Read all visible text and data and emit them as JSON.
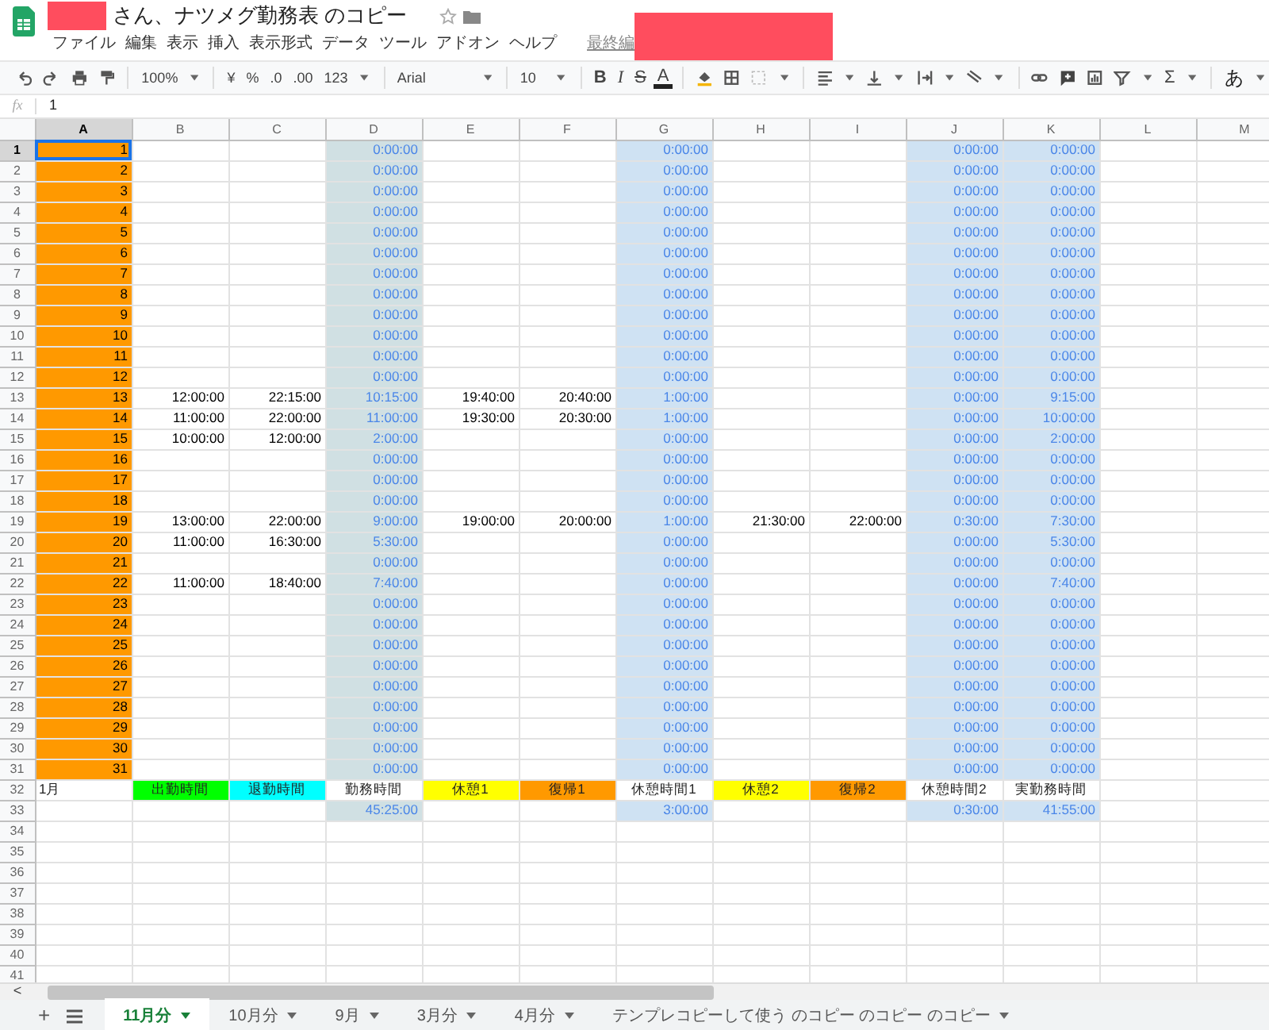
{
  "document": {
    "title": "さん、ナツメグ勤務表 のコピー",
    "last_edit": "最終編"
  },
  "menu": [
    "ファイル",
    "編集",
    "表示",
    "挿入",
    "表示形式",
    "データ",
    "ツール",
    "アドオン",
    "ヘルプ"
  ],
  "toolbar": {
    "zoom": "100%",
    "currency": "¥",
    "percent": "%",
    "decimal_decrease": ".0",
    "decimal_increase": ".00",
    "number_format": "123",
    "font": "Arial",
    "font_size": "10",
    "bold": "B",
    "italic": "I",
    "strikethrough": "S",
    "text_color": "A",
    "functions": "Σ",
    "input_tools": "あ"
  },
  "formula_bar": {
    "label": "fx",
    "value": "1"
  },
  "sheet": {
    "columns": [
      {
        "letter": "A",
        "selected": true,
        "kind": "day",
        "color": "#ff9900"
      },
      {
        "letter": "B",
        "selected": false,
        "kind": "time",
        "color": "#ffffff"
      },
      {
        "letter": "C",
        "selected": false,
        "kind": "time",
        "color": "#ffffff"
      },
      {
        "letter": "D",
        "selected": false,
        "kind": "duration",
        "color": "#d0e0e3"
      },
      {
        "letter": "E",
        "selected": false,
        "kind": "time",
        "color": "#ffffff"
      },
      {
        "letter": "F",
        "selected": false,
        "kind": "time",
        "color": "#ffffff"
      },
      {
        "letter": "G",
        "selected": false,
        "kind": "duration",
        "color": "#cfe2f3"
      },
      {
        "letter": "H",
        "selected": false,
        "kind": "time",
        "color": "#ffffff"
      },
      {
        "letter": "I",
        "selected": false,
        "kind": "time",
        "color": "#ffffff"
      },
      {
        "letter": "J",
        "selected": false,
        "kind": "duration",
        "color": "#cfe2f3"
      },
      {
        "letter": "K",
        "selected": false,
        "kind": "duration",
        "color": "#cfe2f3"
      },
      {
        "letter": "L",
        "selected": false,
        "kind": "empty",
        "color": "#ffffff"
      },
      {
        "letter": "M",
        "selected": false,
        "kind": "empty",
        "color": "#ffffff"
      }
    ],
    "rows": [
      {
        "number": "1",
        "selected": true,
        "kind": "day",
        "cells": {
          "A": "1",
          "D": "0:00:00",
          "G": "0:00:00",
          "J": "0:00:00",
          "K": "0:00:00"
        }
      },
      {
        "number": "2",
        "selected": false,
        "kind": "day",
        "cells": {
          "A": "2",
          "D": "0:00:00",
          "G": "0:00:00",
          "J": "0:00:00",
          "K": "0:00:00"
        }
      },
      {
        "number": "3",
        "selected": false,
        "kind": "day",
        "cells": {
          "A": "3",
          "D": "0:00:00",
          "G": "0:00:00",
          "J": "0:00:00",
          "K": "0:00:00"
        }
      },
      {
        "number": "4",
        "selected": false,
        "kind": "day",
        "cells": {
          "A": "4",
          "D": "0:00:00",
          "G": "0:00:00",
          "J": "0:00:00",
          "K": "0:00:00"
        }
      },
      {
        "number": "5",
        "selected": false,
        "kind": "day",
        "cells": {
          "A": "5",
          "D": "0:00:00",
          "G": "0:00:00",
          "J": "0:00:00",
          "K": "0:00:00"
        }
      },
      {
        "number": "6",
        "selected": false,
        "kind": "day",
        "cells": {
          "A": "6",
          "D": "0:00:00",
          "G": "0:00:00",
          "J": "0:00:00",
          "K": "0:00:00"
        }
      },
      {
        "number": "7",
        "selected": false,
        "kind": "day",
        "cells": {
          "A": "7",
          "D": "0:00:00",
          "G": "0:00:00",
          "J": "0:00:00",
          "K": "0:00:00"
        }
      },
      {
        "number": "8",
        "selected": false,
        "kind": "day",
        "cells": {
          "A": "8",
          "D": "0:00:00",
          "G": "0:00:00",
          "J": "0:00:00",
          "K": "0:00:00"
        }
      },
      {
        "number": "9",
        "selected": false,
        "kind": "day",
        "cells": {
          "A": "9",
          "D": "0:00:00",
          "G": "0:00:00",
          "J": "0:00:00",
          "K": "0:00:00"
        }
      },
      {
        "number": "10",
        "selected": false,
        "kind": "day",
        "cells": {
          "A": "10",
          "D": "0:00:00",
          "G": "0:00:00",
          "J": "0:00:00",
          "K": "0:00:00"
        }
      },
      {
        "number": "11",
        "selected": false,
        "kind": "day",
        "cells": {
          "A": "11",
          "D": "0:00:00",
          "G": "0:00:00",
          "J": "0:00:00",
          "K": "0:00:00"
        }
      },
      {
        "number": "12",
        "selected": false,
        "kind": "day",
        "cells": {
          "A": "12",
          "D": "0:00:00",
          "G": "0:00:00",
          "J": "0:00:00",
          "K": "0:00:00"
        }
      },
      {
        "number": "13",
        "selected": false,
        "kind": "day",
        "cells": {
          "A": "13",
          "B": "12:00:00",
          "C": "22:15:00",
          "D": "10:15:00",
          "E": "19:40:00",
          "F": "20:40:00",
          "G": "1:00:00",
          "J": "0:00:00",
          "K": "9:15:00"
        }
      },
      {
        "number": "14",
        "selected": false,
        "kind": "day",
        "cells": {
          "A": "14",
          "B": "11:00:00",
          "C": "22:00:00",
          "D": "11:00:00",
          "E": "19:30:00",
          "F": "20:30:00",
          "G": "1:00:00",
          "J": "0:00:00",
          "K": "10:00:00"
        }
      },
      {
        "number": "15",
        "selected": false,
        "kind": "day",
        "cells": {
          "A": "15",
          "B": "10:00:00",
          "C": "12:00:00",
          "D": "2:00:00",
          "G": "0:00:00",
          "J": "0:00:00",
          "K": "2:00:00"
        }
      },
      {
        "number": "16",
        "selected": false,
        "kind": "day",
        "cells": {
          "A": "16",
          "D": "0:00:00",
          "G": "0:00:00",
          "J": "0:00:00",
          "K": "0:00:00"
        }
      },
      {
        "number": "17",
        "selected": false,
        "kind": "day",
        "cells": {
          "A": "17",
          "D": "0:00:00",
          "G": "0:00:00",
          "J": "0:00:00",
          "K": "0:00:00"
        }
      },
      {
        "number": "18",
        "selected": false,
        "kind": "day",
        "cells": {
          "A": "18",
          "D": "0:00:00",
          "G": "0:00:00",
          "J": "0:00:00",
          "K": "0:00:00"
        }
      },
      {
        "number": "19",
        "selected": false,
        "kind": "day",
        "cells": {
          "A": "19",
          "B": "13:00:00",
          "C": "22:00:00",
          "D": "9:00:00",
          "E": "19:00:00",
          "F": "20:00:00",
          "G": "1:00:00",
          "H": "21:30:00",
          "I": "22:00:00",
          "J": "0:30:00",
          "K": "7:30:00"
        }
      },
      {
        "number": "20",
        "selected": false,
        "kind": "day",
        "cells": {
          "A": "20",
          "B": "11:00:00",
          "C": "16:30:00",
          "D": "5:30:00",
          "G": "0:00:00",
          "J": "0:00:00",
          "K": "5:30:00"
        }
      },
      {
        "number": "21",
        "selected": false,
        "kind": "day",
        "cells": {
          "A": "21",
          "D": "0:00:00",
          "G": "0:00:00",
          "J": "0:00:00",
          "K": "0:00:00"
        }
      },
      {
        "number": "22",
        "selected": false,
        "kind": "day",
        "cells": {
          "A": "22",
          "B": "11:00:00",
          "C": "18:40:00",
          "D": "7:40:00",
          "G": "0:00:00",
          "J": "0:00:00",
          "K": "7:40:00"
        }
      },
      {
        "number": "23",
        "selected": false,
        "kind": "day",
        "cells": {
          "A": "23",
          "D": "0:00:00",
          "G": "0:00:00",
          "J": "0:00:00",
          "K": "0:00:00"
        }
      },
      {
        "number": "24",
        "selected": false,
        "kind": "day",
        "cells": {
          "A": "24",
          "D": "0:00:00",
          "G": "0:00:00",
          "J": "0:00:00",
          "K": "0:00:00"
        }
      },
      {
        "number": "25",
        "selected": false,
        "kind": "day",
        "cells": {
          "A": "25",
          "D": "0:00:00",
          "G": "0:00:00",
          "J": "0:00:00",
          "K": "0:00:00"
        }
      },
      {
        "number": "26",
        "selected": false,
        "kind": "day",
        "cells": {
          "A": "26",
          "D": "0:00:00",
          "G": "0:00:00",
          "J": "0:00:00",
          "K": "0:00:00"
        }
      },
      {
        "number": "27",
        "selected": false,
        "kind": "day",
        "cells": {
          "A": "27",
          "D": "0:00:00",
          "G": "0:00:00",
          "J": "0:00:00",
          "K": "0:00:00"
        }
      },
      {
        "number": "28",
        "selected": false,
        "kind": "day",
        "cells": {
          "A": "28",
          "D": "0:00:00",
          "G": "0:00:00",
          "J": "0:00:00",
          "K": "0:00:00"
        }
      },
      {
        "number": "29",
        "selected": false,
        "kind": "day",
        "cells": {
          "A": "29",
          "D": "0:00:00",
          "G": "0:00:00",
          "J": "0:00:00",
          "K": "0:00:00"
        }
      },
      {
        "number": "30",
        "selected": false,
        "kind": "day",
        "cells": {
          "A": "30",
          "D": "0:00:00",
          "G": "0:00:00",
          "J": "0:00:00",
          "K": "0:00:00"
        }
      },
      {
        "number": "31",
        "selected": false,
        "kind": "day",
        "cells": {
          "A": "31",
          "D": "0:00:00",
          "G": "0:00:00",
          "J": "0:00:00",
          "K": "0:00:00"
        }
      },
      {
        "number": "32",
        "selected": false,
        "kind": "label",
        "cells": {
          "A": {
            "text": "1月",
            "color": "#ffffff"
          },
          "B": {
            "text": "出勤時間",
            "color": "#00ff00"
          },
          "C": {
            "text": "退勤時間",
            "color": "#00ffff"
          },
          "D": {
            "text": "勤務時間",
            "color": "#ffffff"
          },
          "E": {
            "text": "休憩1",
            "color": "#ffff00"
          },
          "F": {
            "text": "復帰1",
            "color": "#ff9900"
          },
          "G": {
            "text": "休憩時間1",
            "color": "#ffffff"
          },
          "H": {
            "text": "休憩2",
            "color": "#ffff00"
          },
          "I": {
            "text": "復帰2",
            "color": "#ff9900"
          },
          "J": {
            "text": "休憩時間2",
            "color": "#ffffff"
          },
          "K": {
            "text": "実勤務時間",
            "color": "#ffffff"
          }
        }
      },
      {
        "number": "33",
        "selected": false,
        "kind": "total",
        "cells": {
          "D": "45:25:00",
          "G": "3:00:00",
          "J": "0:30:00",
          "K": "41:55:00"
        }
      },
      {
        "number": "34",
        "selected": false,
        "kind": "blank"
      },
      {
        "number": "35",
        "selected": false,
        "kind": "blank"
      },
      {
        "number": "36",
        "selected": false,
        "kind": "blank"
      },
      {
        "number": "37",
        "selected": false,
        "kind": "blank"
      },
      {
        "number": "38",
        "selected": false,
        "kind": "blank"
      },
      {
        "number": "39",
        "selected": false,
        "kind": "blank"
      },
      {
        "number": "40",
        "selected": false,
        "kind": "blank"
      },
      {
        "number": "41",
        "selected": false,
        "kind": "blank"
      }
    ]
  },
  "scroll_left": "<",
  "add_sheet": "+",
  "tabs": [
    {
      "label": "11月分",
      "selected": true
    },
    {
      "label": "10月分",
      "selected": false
    },
    {
      "label": "9月",
      "selected": false
    },
    {
      "label": "3月分",
      "selected": false
    },
    {
      "label": "4月分",
      "selected": false
    },
    {
      "label": "テンプレコピーして使う のコピー のコピー のコピー",
      "selected": false
    }
  ]
}
